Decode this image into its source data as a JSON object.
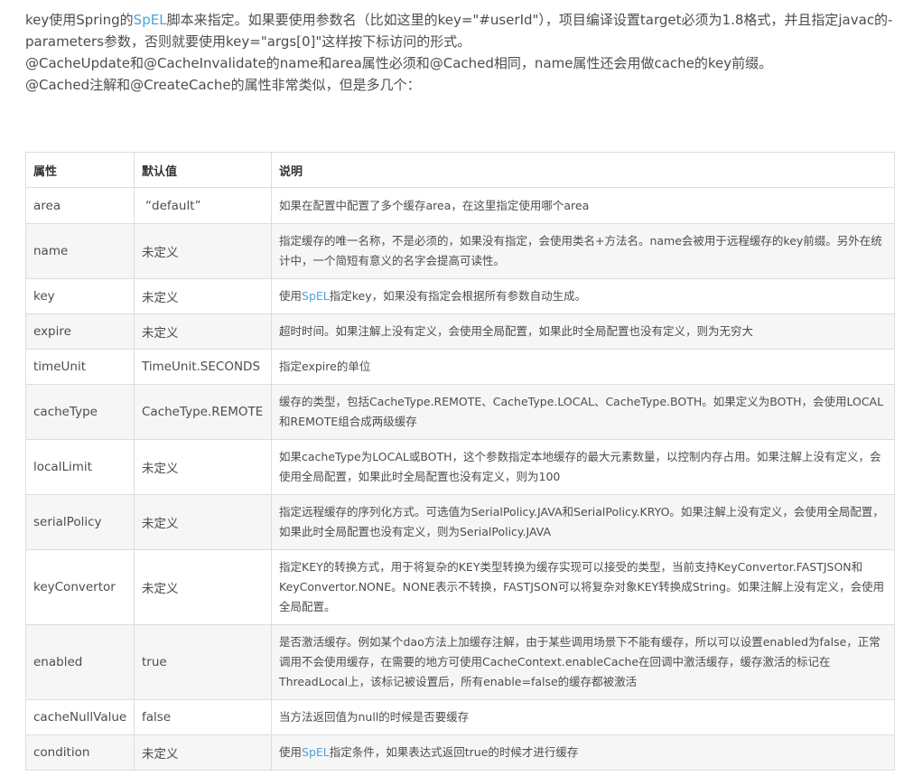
{
  "paragraphs": {
    "p1_a": "key使用Spring的",
    "p1_link": "SpEL",
    "p1_b": "脚本来指定。如果要使用参数名（比如这里的key=\"#userId\"），项目编译设置target必须为1.8格式，并且指定javac的-parameters参数，否则就要使用key=\"args[0]\"这样按下标访问的形式。",
    "p2": "@CacheUpdate和@CacheInvalidate的name和area属性必须和@Cached相同，name属性还会用做cache的key前缀。",
    "p3": "@Cached注解和@CreateCache的属性非常类似，但是多几个："
  },
  "table": {
    "headers": [
      "属性",
      "默认值",
      "说明"
    ],
    "rows": [
      {
        "attr": "area",
        "default": "“default”",
        "desc": "如果在配置中配置了多个缓存area，在这里指定使用哪个area"
      },
      {
        "attr": "name",
        "default": "未定义",
        "desc": "指定缓存的唯一名称，不是必须的，如果没有指定，会使用类名+方法名。name会被用于远程缓存的key前缀。另外在统计中，一个简短有意义的名字会提高可读性。"
      },
      {
        "attr": "key",
        "default": "未定义",
        "desc_a": "使用",
        "desc_link": "SpEL",
        "desc_b": "指定key，如果没有指定会根据所有参数自动生成。"
      },
      {
        "attr": "expire",
        "default": "未定义",
        "desc": "超时时间。如果注解上没有定义，会使用全局配置，如果此时全局配置也没有定义，则为无穷大"
      },
      {
        "attr": "timeUnit",
        "default": "TimeUnit.SECONDS",
        "desc": "指定expire的单位"
      },
      {
        "attr": "cacheType",
        "default": "CacheType.REMOTE",
        "desc": "缓存的类型，包括CacheType.REMOTE、CacheType.LOCAL、CacheType.BOTH。如果定义为BOTH，会使用LOCAL和REMOTE组合成两级缓存"
      },
      {
        "attr": "localLimit",
        "default": "未定义",
        "desc": "如果cacheType为LOCAL或BOTH，这个参数指定本地缓存的最大元素数量，以控制内存占用。如果注解上没有定义，会使用全局配置，如果此时全局配置也没有定义，则为100"
      },
      {
        "attr": "serialPolicy",
        "default": "未定义",
        "desc": "指定远程缓存的序列化方式。可选值为SerialPolicy.JAVA和SerialPolicy.KRYO。如果注解上没有定义，会使用全局配置，如果此时全局配置也没有定义，则为SerialPolicy.JAVA"
      },
      {
        "attr": "keyConvertor",
        "default": "未定义",
        "desc": "指定KEY的转换方式，用于将复杂的KEY类型转换为缓存实现可以接受的类型，当前支持KeyConvertor.FASTJSON和KeyConvertor.NONE。NONE表示不转换，FASTJSON可以将复杂对象KEY转换成String。如果注解上没有定义，会使用全局配置。"
      },
      {
        "attr": "enabled",
        "default": "true",
        "desc": "是否激活缓存。例如某个dao方法上加缓存注解，由于某些调用场景下不能有缓存，所以可以设置enabled为false，正常调用不会使用缓存，在需要的地方可使用CacheContext.enableCache在回调中激活缓存，缓存激活的标记在ThreadLocal上，该标记被设置后，所有enable=false的缓存都被激活"
      },
      {
        "attr": "cacheNullValue",
        "default": "false",
        "desc": "当方法返回值为null的时候是否要缓存"
      },
      {
        "attr": "condition",
        "default": "未定义",
        "desc_a": "使用",
        "desc_link": "SpEL",
        "desc_b": "指定条件，如果表达式返回true的时候才进行缓存"
      }
    ]
  },
  "colors": {
    "link": "#4ea1db",
    "text": "#4d4d4d",
    "border": "#dddddd",
    "row_stripe": "#f6f6f6"
  }
}
